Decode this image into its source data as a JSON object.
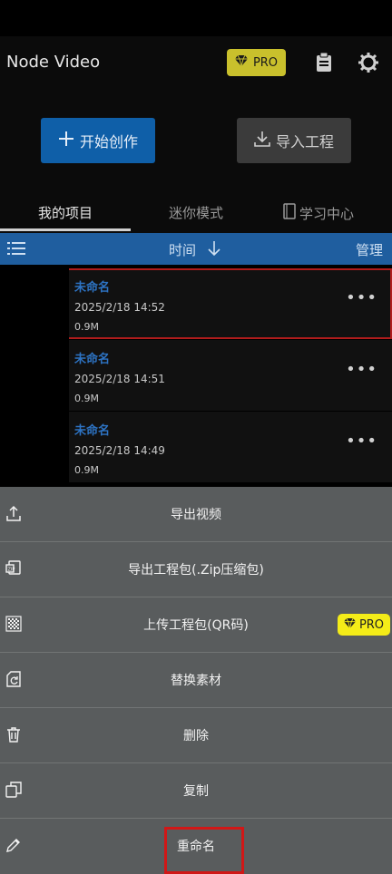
{
  "header": {
    "title": "Node Video",
    "pro_label": "PRO",
    "icons": [
      "diamond-icon",
      "clipboard-icon",
      "gear-icon"
    ]
  },
  "toolbar": {
    "create_label": "开始创作",
    "import_label": "导入工程"
  },
  "tabs": [
    {
      "label": "我的项目",
      "active": true
    },
    {
      "label": "迷你模式",
      "active": false
    },
    {
      "label": "学习中心",
      "active": false
    }
  ],
  "sort_bar": {
    "label": "时间",
    "manage_label": "管理"
  },
  "projects": [
    {
      "name": "未命名",
      "date": "2025/2/18 14:52",
      "size": "0.9M",
      "more": "•••"
    },
    {
      "name": "未命名",
      "date": "2025/2/18 14:51",
      "size": "0.9M",
      "more": "•••"
    },
    {
      "name": "未命名",
      "date": "2025/2/18 14:49",
      "size": "0.9M",
      "more": "•••"
    }
  ],
  "sheet": {
    "items": [
      {
        "label": "导出视频",
        "icon": "upload-icon"
      },
      {
        "label": "导出工程包(.Zip压缩包)",
        "icon": "zip-icon"
      },
      {
        "label": "上传工程包(QR码)",
        "icon": "qr-icon",
        "pro": "PRO"
      },
      {
        "label": "替换素材",
        "icon": "replace-icon"
      },
      {
        "label": "删除",
        "icon": "trash-icon"
      },
      {
        "label": "复制",
        "icon": "copy-icon"
      },
      {
        "label": "重命名",
        "icon": "pencil-icon"
      }
    ]
  },
  "colors": {
    "accent": "#0f5fa8",
    "sort_bar": "#1f5e9f",
    "pro_badge": "#c9c02c",
    "pro_yellow": "#f4ec18",
    "sheet": "#595c5d",
    "highlight": "#d11717"
  }
}
